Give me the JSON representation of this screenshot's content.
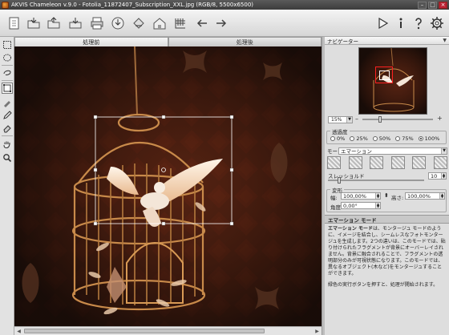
{
  "titlebar": {
    "title": "AKVIS Chameleon v.9.0 - Fotolia_11872407_Subscription_XXL.jpg (RGB/8, 5500x6500)",
    "minimize": "–",
    "maximize": "□",
    "close": "×"
  },
  "toolbar": {
    "icons": [
      "open-icon",
      "save-icon",
      "open-folder-icon",
      "image-icon",
      "print-icon",
      "share-icon",
      "paint-bucket-icon",
      "home-icon",
      "table-icon",
      "undo-icon",
      "redo-icon",
      "run-icon",
      "info-icon",
      "help-icon",
      "settings-icon"
    ]
  },
  "tabs": {
    "before": "処理前",
    "after": "処理後"
  },
  "navigator": {
    "title": "ナビゲーター",
    "zoom": "15%"
  },
  "transparency": {
    "label": "透過度",
    "options": [
      "0%",
      "25%",
      "50%",
      "75%",
      "100%"
    ],
    "selected": "100%"
  },
  "mode": {
    "label": "モード",
    "value": "エマーション"
  },
  "threshold": {
    "label": "スレッショルド",
    "value": "10",
    "fraction": 0.1
  },
  "transform": {
    "label": "変形",
    "width_label": "幅:",
    "width_value": "100,00%",
    "height_label": "高さ:",
    "height_value": "100,00%",
    "angle_label": "角度:",
    "angle_value": "0,00°"
  },
  "help": {
    "title": "エマーション モード",
    "paragraph1_bold": "エマーション モード",
    "paragraph1": "は、モンタージュ モードのように、イメージを結合し、シームレスなフォトモンタージュを生成します。2つの違いは、このモードでは、貼り付けられたフラグメントが背景にオーバーレイされません。背景に融合されることで、フラグメントの透明部分のみが可視状態になります。このモードでは、異なるオブジェクト(木など)をモンタージュすることができます。",
    "paragraph2": "緑色の実行ボタンを押すと、処理が開始されます。"
  },
  "colors": {
    "canvas_bg": "#2a1810",
    "selection": "#ffffff",
    "nav_frame": "#ff2020"
  }
}
